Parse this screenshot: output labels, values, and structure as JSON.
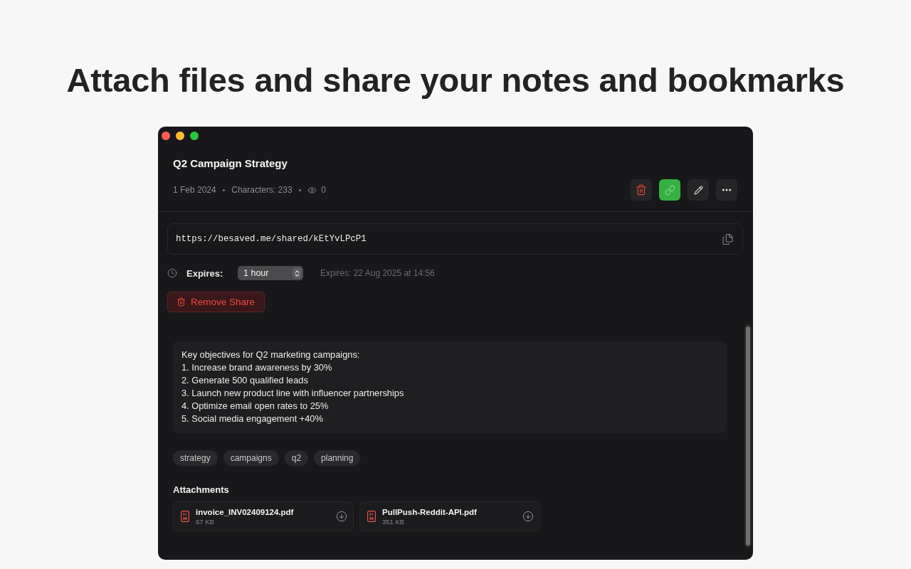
{
  "headline": "Attach files and share your notes and bookmarks",
  "note": {
    "title": "Q2 Campaign Strategy",
    "meta": [
      {
        "kind": "text",
        "text": "1 Feb 2024"
      },
      {
        "kind": "dot",
        "text": "•"
      },
      {
        "kind": "text",
        "text": "Characters: 233"
      },
      {
        "kind": "dot",
        "text": "•"
      },
      {
        "kind": "views",
        "text": "0"
      }
    ],
    "actions": [
      {
        "kind": "delete",
        "on": false
      },
      {
        "kind": "link",
        "on": true
      },
      {
        "kind": "edit",
        "on": false
      },
      {
        "kind": "more",
        "on": false
      }
    ]
  },
  "share": {
    "url": "https://besaved.me/shared/kEtYvLPcP1",
    "expires_label": "Expires:",
    "duration": "1 hour",
    "expiry_note": "Expires: 22 Aug 2025 at 14:56",
    "remove_button": "Remove Share"
  },
  "content": {
    "lines": [
      "Key objectives for Q2 marketing campaigns:",
      "1. Increase brand awareness by 30%",
      "2. Generate 500 qualified leads",
      "3. Launch new product line with influencer partnerships",
      "4. Optimize email open rates to 25%",
      "5. Social media engagement +40%"
    ]
  },
  "tags": [
    "strategy",
    "campaigns",
    "q2",
    "planning"
  ],
  "attachments": {
    "title": "Attachments",
    "files": [
      {
        "name": "invoice_INV02409124.pdf",
        "size": "67 KB"
      },
      {
        "name": "PullPush-Reddit-API.pdf",
        "size": "351 KB"
      }
    ]
  }
}
